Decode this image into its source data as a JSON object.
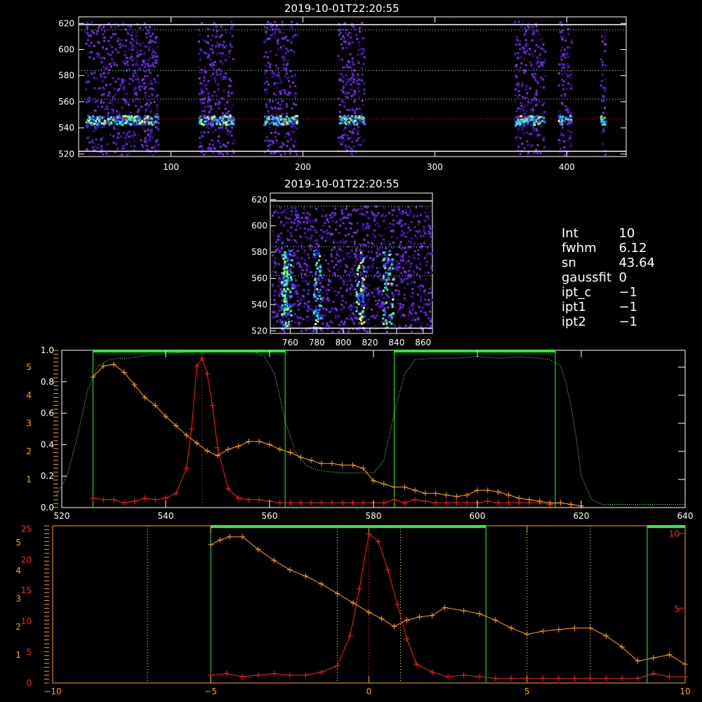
{
  "colors": {
    "background": "#000000",
    "axis": "#ffffff",
    "orange": "#ffa020",
    "red": "#ff2020",
    "green": "#20ff20",
    "green_dotted": "#a0ffa0",
    "yellow_dotted": "#ffff80"
  },
  "top_image": {
    "title": "2019-10-01T22:20:55",
    "x_ticks": [
      "100",
      "200",
      "300",
      "400"
    ],
    "y_ticks": [
      "520",
      "540",
      "560",
      "580",
      "600",
      "620"
    ]
  },
  "mid_image": {
    "title": "2019-10-01T22:20:55",
    "x_ticks": [
      "760",
      "780",
      "800",
      "820",
      "840",
      "860"
    ],
    "y_ticks": [
      "520",
      "540",
      "560",
      "580",
      "600",
      "620"
    ]
  },
  "params": [
    {
      "key": "Int",
      "value": "10"
    },
    {
      "key": "fwhm",
      "value": "6.12"
    },
    {
      "key": "sn",
      "value": "43.64"
    },
    {
      "key": "gaussfit",
      "value": "0"
    },
    {
      "key": "ipt_c",
      "value": "−1"
    },
    {
      "key": "ipt1",
      "value": "−1"
    },
    {
      "key": "ipt2",
      "value": "−1"
    }
  ],
  "chart_data": [
    {
      "type": "line",
      "x_ticks": [
        "520",
        "540",
        "560",
        "580",
        "600",
        "620",
        "640"
      ],
      "xlim": [
        520,
        640
      ],
      "left_ticks_white": [
        "0.0",
        "0.2",
        "0.4",
        "0.6",
        "0.8",
        "1.0"
      ],
      "left_ticks_orange": [
        "1",
        "2",
        "3",
        "4",
        "5"
      ],
      "ylim": [
        0,
        1.0
      ],
      "series": [
        {
          "color": "red",
          "x": [
            526,
            528,
            530,
            532,
            534,
            536,
            538,
            540,
            542,
            544,
            545,
            546,
            547,
            548,
            549,
            550,
            552,
            554,
            556,
            558,
            560,
            562,
            564,
            566,
            568,
            570,
            572,
            574,
            576,
            578,
            580,
            582,
            584,
            586,
            588,
            590,
            592,
            594,
            596,
            598,
            600,
            602,
            604,
            606,
            608,
            610,
            612,
            614,
            616,
            618,
            620
          ],
          "y": [
            0.06,
            0.05,
            0.05,
            0.03,
            0.04,
            0.06,
            0.05,
            0.06,
            0.09,
            0.25,
            0.5,
            0.9,
            0.95,
            0.85,
            0.65,
            0.38,
            0.12,
            0.06,
            0.05,
            0.05,
            0.04,
            0.03,
            0.03,
            0.03,
            0.03,
            0.03,
            0.03,
            0.03,
            0.03,
            0.03,
            0.03,
            0.03,
            0.05,
            0.03,
            0.05,
            0.04,
            0.03,
            0.03,
            0.03,
            0.03,
            0.03,
            0.04,
            0.03,
            0.03,
            0.03,
            0.03,
            0.03,
            0.02,
            0.03,
            0.02,
            0.01
          ]
        },
        {
          "color": "orange",
          "x": [
            526,
            528,
            530,
            532,
            534,
            536,
            538,
            540,
            542,
            544,
            546,
            548,
            550,
            552,
            554,
            556,
            558,
            560,
            562,
            564,
            566,
            568,
            570,
            572,
            574,
            576,
            578,
            580,
            582,
            584,
            586,
            588,
            590,
            592,
            594,
            596,
            598,
            600,
            602,
            604,
            606,
            608,
            610,
            612,
            614,
            616,
            618,
            620
          ],
          "y": [
            0.83,
            0.9,
            0.91,
            0.86,
            0.78,
            0.7,
            0.65,
            0.58,
            0.52,
            0.46,
            0.41,
            0.36,
            0.33,
            0.37,
            0.39,
            0.42,
            0.42,
            0.4,
            0.37,
            0.35,
            0.32,
            0.3,
            0.28,
            0.28,
            0.27,
            0.27,
            0.25,
            0.17,
            0.15,
            0.13,
            0.13,
            0.11,
            0.09,
            0.09,
            0.08,
            0.07,
            0.08,
            0.11,
            0.11,
            0.1,
            0.08,
            0.06,
            0.05,
            0.04,
            0.03,
            0.03,
            0.02,
            0.01
          ]
        },
        {
          "color": "green_dotted",
          "x": [
            519,
            521,
            523,
            525,
            527,
            529,
            531,
            533,
            535,
            537,
            540,
            545,
            550,
            555,
            557,
            559,
            561,
            563,
            565,
            567,
            569,
            571,
            574,
            577,
            580,
            582,
            584,
            586,
            588,
            592,
            596,
            600,
            604,
            608,
            612,
            614,
            616,
            617,
            618,
            619,
            620,
            622,
            624,
            628,
            632,
            636,
            640
          ],
          "y": [
            0.08,
            0.2,
            0.45,
            0.75,
            0.9,
            0.94,
            0.95,
            0.95,
            0.96,
            0.97,
            0.98,
            0.99,
            0.99,
            0.99,
            0.99,
            0.96,
            0.85,
            0.55,
            0.35,
            0.27,
            0.24,
            0.23,
            0.22,
            0.22,
            0.22,
            0.3,
            0.6,
            0.85,
            0.94,
            0.95,
            0.95,
            0.96,
            0.95,
            0.96,
            0.95,
            0.94,
            0.9,
            0.8,
            0.65,
            0.45,
            0.2,
            0.05,
            0.02,
            0.02,
            0.02,
            0.02,
            0.02
          ]
        }
      ],
      "green_boxes": [
        [
          526,
          563
        ],
        [
          584,
          615
        ]
      ],
      "dotted_verticals": [
        547
      ]
    },
    {
      "type": "line",
      "x_ticks": [
        "−10",
        "−5",
        "0",
        "5",
        "10"
      ],
      "xlim": [
        -10,
        10
      ],
      "left_ticks_red": [
        "0",
        "5",
        "10",
        "15",
        "20",
        "25"
      ],
      "left_ticks_orange": [
        "1",
        "2",
        "3",
        "4",
        "5"
      ],
      "right_ticks_red": [
        "5",
        "10"
      ],
      "ylim": [
        0,
        1.0
      ],
      "series": [
        {
          "color": "red",
          "x": [
            -5,
            -4.5,
            -4,
            -3.5,
            -3,
            -2.5,
            -2,
            -1.5,
            -1,
            -0.6,
            -0.3,
            0,
            0.3,
            0.6,
            0.9,
            1.2,
            1.5,
            2,
            2.5,
            3,
            3.5,
            4,
            4.5,
            5,
            5.5,
            6,
            6.5,
            7,
            7.5,
            8,
            8.5,
            9,
            9.5,
            10
          ],
          "y": [
            0.05,
            0.06,
            0.04,
            0.05,
            0.06,
            0.05,
            0.05,
            0.07,
            0.11,
            0.3,
            0.6,
            0.95,
            0.9,
            0.72,
            0.5,
            0.28,
            0.12,
            0.07,
            0.04,
            0.05,
            0.04,
            0.03,
            0.03,
            0.03,
            0.03,
            0.03,
            0.03,
            0.03,
            0.03,
            0.03,
            0.03,
            0.06,
            0.04,
            0.04
          ]
        },
        {
          "color": "orange",
          "x": [
            -5,
            -4.7,
            -4.4,
            -4,
            -3.5,
            -3,
            -2.5,
            -2,
            -1.5,
            -1,
            -0.5,
            0,
            0.4,
            0.8,
            1.2,
            1.6,
            2,
            2.4,
            3,
            3.5,
            4,
            4.5,
            5,
            5.5,
            6,
            6.5,
            7,
            7.5,
            8,
            8.5,
            9,
            9.5,
            10
          ],
          "y": [
            0.88,
            0.91,
            0.93,
            0.93,
            0.85,
            0.78,
            0.72,
            0.68,
            0.63,
            0.57,
            0.51,
            0.45,
            0.41,
            0.36,
            0.4,
            0.42,
            0.43,
            0.48,
            0.46,
            0.44,
            0.4,
            0.35,
            0.31,
            0.33,
            0.34,
            0.35,
            0.35,
            0.3,
            0.23,
            0.14,
            0.16,
            0.18,
            0.12
          ]
        }
      ],
      "green_boxes": [
        [
          -5,
          3.7
        ],
        [
          8.8,
          10
        ]
      ],
      "dotted_verticals": [
        -7,
        -1,
        0,
        1,
        5,
        7
      ]
    }
  ]
}
